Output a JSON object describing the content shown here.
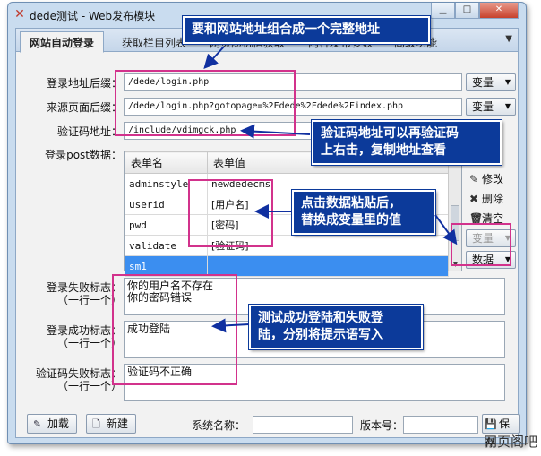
{
  "window": {
    "title": "dede测试 - Web发布模块",
    "app_icon": "tool-icon",
    "buttons": [
      "minimize-icon",
      "maximize-icon",
      "close-icon"
    ]
  },
  "tabs": [
    {
      "label": "网站自动登录",
      "active": true
    },
    {
      "label": "获取栏目列表",
      "active": false
    },
    {
      "label": "网页随机值获取",
      "active": false
    },
    {
      "label": "内容发布参数",
      "active": false
    },
    {
      "label": "高级功能",
      "active": false
    }
  ],
  "form": {
    "login_suffix_label": "登录地址后缀：",
    "login_suffix_value": "/dede/login.php",
    "source_suffix_label": "来源页面后缀：",
    "source_suffix_value": "/dede/login.php?gotopage=%2Fdede%2Fdede%2Findex.php",
    "captcha_label": "验证码地址：",
    "captcha_value": "/include/vdimgck.php",
    "post_label": "登录post数据：",
    "var_button": "变量",
    "data_button": "数据"
  },
  "grid": {
    "columns": [
      "表单名",
      "表单值"
    ],
    "rows": [
      {
        "name": "adminstyle",
        "value": "newdedecms"
      },
      {
        "name": "userid",
        "value": "[用户名]"
      },
      {
        "name": "pwd",
        "value": "[密码]"
      },
      {
        "name": "validate",
        "value": "[验证码]"
      },
      {
        "name": "sm1",
        "value": ""
      }
    ],
    "selected_row": 4
  },
  "side_buttons": {
    "edit": "修改",
    "delete": "删除",
    "clear": "清空"
  },
  "flags": {
    "fail_label": "登录失败标志：",
    "fail_hint": "（一行一个）",
    "fail_value": "你的用户名不存在\n你的密码错误",
    "success_label": "登录成功标志：",
    "success_hint": "（一行一个）",
    "success_value": "成功登陆",
    "captcha_fail_label": "验证码失败标志：",
    "captcha_fail_hint": "（一行一个）",
    "captcha_fail_value": "验证码不正确"
  },
  "bottom": {
    "load_button": "加载",
    "new_button": "新建",
    "system_name_label": "系统名称：",
    "version_label": "版本号：",
    "save_button": "保存"
  },
  "callouts": {
    "c1": "要和网站地址组合成一个完整地址",
    "c2": "验证码地址可以再验证码\n上右击，复制地址查看",
    "c3": "点击数据粘贴后，\n替换成变量里的值",
    "c4": "测试成功登陆和失败登\n陆，分别将提示语写入"
  },
  "watermark": "网页阁吧"
}
